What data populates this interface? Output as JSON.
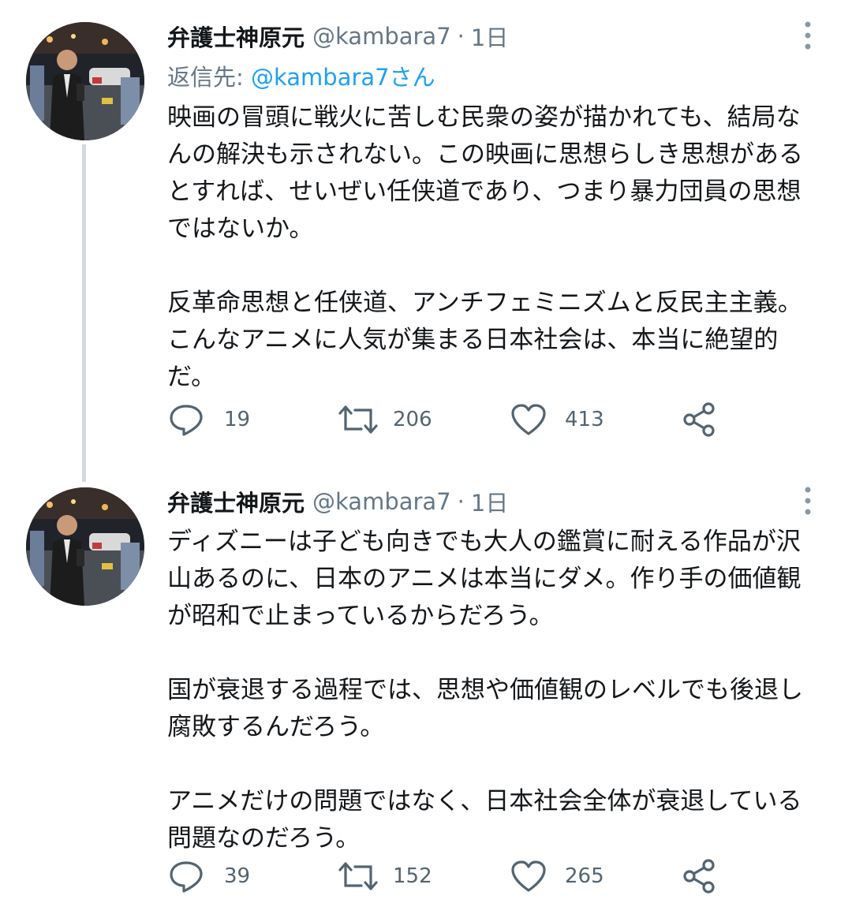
{
  "tweets": [
    {
      "display_name": "弁護士神原元",
      "handle": "@kambara7",
      "separator": "·",
      "age": "1日",
      "reply_prefix": "返信先:",
      "reply_mention": "@kambara7さん",
      "paragraphs": [
        "映画の冒頭に戦火に苦しむ民衆の姿が描かれても、結局なんの解決も示されない。この映画に思想らしき思想があるとすれば、せいぜい任侠道であり、つまり暴力団員の思想ではないか。",
        "反革命思想と任侠道、アンチフェミニズムと反民主主義。こんなアニメに人気が集まる日本社会は、本当に絶望的だ。"
      ],
      "replies": "19",
      "retweets": "206",
      "likes": "413"
    },
    {
      "display_name": "弁護士神原元",
      "handle": "@kambara7",
      "separator": "·",
      "age": "1日",
      "paragraphs": [
        "ディズニーは子ども向きでも大人の鑑賞に耐える作品が沢山あるのに、日本のアニメは本当にダメ。作り手の価値観が昭和で止まっているからだろう。",
        "国が衰退する過程では、思想や価値観のレベルでも後退し腐敗するんだろう。",
        "アニメだけの問題ではなく、日本社会全体が衰退している問題なのだろう。"
      ],
      "replies": "39",
      "retweets": "152",
      "likes": "265"
    }
  ],
  "icons": {
    "reply": "reply-icon",
    "retweet": "retweet-icon",
    "like": "heart-icon",
    "share": "share-icon",
    "more": "more-vertical-icon"
  },
  "colors": {
    "text": "#14171a",
    "secondary": "#657786",
    "link": "#1da1f2",
    "thread_line": "#cfd9de"
  }
}
